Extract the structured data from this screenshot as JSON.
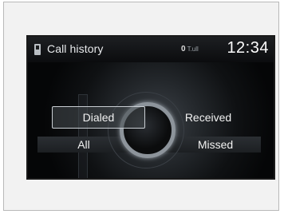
{
  "statusbar": {
    "title": "Call history",
    "indicator_count": "0",
    "indicator_signal": "T.ull",
    "clock": "12:34"
  },
  "options": {
    "dialed": "Dialed",
    "received": "Received",
    "all": "All",
    "missed": "Missed"
  },
  "selected": "Dialed",
  "icons": {
    "phone": "phone-icon",
    "knob": "selector-knob-icon"
  }
}
